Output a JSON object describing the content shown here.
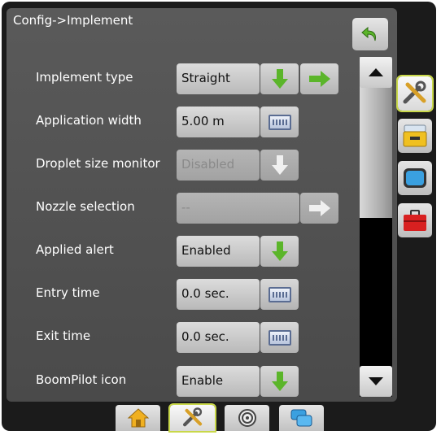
{
  "screen": {
    "title": "Config->Implement"
  },
  "rows": [
    {
      "label": "Implement type",
      "value": "Straight"
    },
    {
      "label": "Application width",
      "value": "5.00 m"
    },
    {
      "label": "Droplet size monitor",
      "value": "Disabled"
    },
    {
      "label": "Nozzle selection",
      "value": "--"
    },
    {
      "label": "Applied alert",
      "value": "Enabled"
    },
    {
      "label": "Entry time",
      "value": "0.0 sec."
    },
    {
      "label": "Exit time",
      "value": "0.0 sec."
    },
    {
      "label": "BoomPilot icon",
      "value": "Enable"
    }
  ],
  "icons": {
    "back": "back-arrow-icon",
    "dropdown": "green-down-arrow-icon",
    "next": "green-right-arrow-icon",
    "keyboard": "keyboard-icon",
    "side_tabs": [
      "tools-icon",
      "console-icon",
      "display-icon",
      "toolbox-icon"
    ],
    "bottom_tabs": [
      "home-icon",
      "tools-icon",
      "gauge-icon",
      "layers-icon"
    ]
  },
  "colors": {
    "accent_green": "#5bb52a",
    "selected_outline": "#c9d84a",
    "background": "#4e4e4e"
  }
}
